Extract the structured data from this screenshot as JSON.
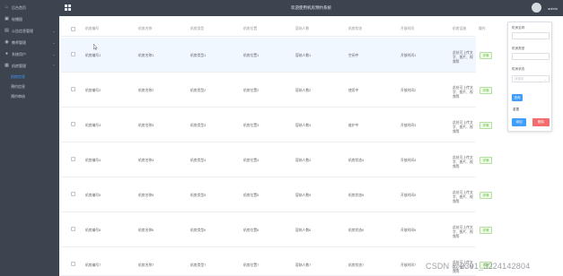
{
  "topbar": {
    "title": "欢迎使用机房预约系统",
    "admin": "admin"
  },
  "sidebar": {
    "items": [
      {
        "label": "后台首页",
        "icon": "home-icon"
      },
      {
        "label": "轮播图",
        "icon": "image-icon"
      },
      {
        "label": "公告信息管理",
        "icon": "notice-icon"
      },
      {
        "label": "教师管理",
        "icon": "teacher-icon"
      },
      {
        "label": "系统用户",
        "icon": "user-icon"
      },
      {
        "label": "机房管理",
        "icon": "computer-room-icon"
      }
    ],
    "sub_items": [
      {
        "label": "机房信息",
        "active": true
      },
      {
        "label": "预约信息",
        "active": false
      },
      {
        "label": "预约审核",
        "active": false
      }
    ]
  },
  "table": {
    "headers": [
      "机房编号",
      "机房名称",
      "机房类型",
      "机房位置",
      "容纳人数",
      "机房状态",
      "开放时间",
      "机房设施",
      "操作"
    ],
    "detail_label": "详情",
    "rows": [
      {
        "no": "机房编号1",
        "name": "机房名称1",
        "type": "机房类型1",
        "loc": "机房位置1",
        "cap": "容纳人数1",
        "status": "空闲中",
        "open": "开放时间1",
        "fac": "此处可上传文字、图片、视频等"
      },
      {
        "no": "机房编号2",
        "name": "机房名称2",
        "type": "机房类型2",
        "loc": "机房位置2",
        "cap": "容纳人数2",
        "status": "使用中",
        "open": "开放时间2",
        "fac": "此处可上传文字、图片、视频等"
      },
      {
        "no": "机房编号3",
        "name": "机房名称3",
        "type": "机房类型3",
        "loc": "机房位置3",
        "cap": "容纳人数3",
        "status": "维护中",
        "open": "开放时间3",
        "fac": "此处可上传文字、图片、视频等"
      },
      {
        "no": "机房编号4",
        "name": "机房名称4",
        "type": "机房类型4",
        "loc": "机房位置4",
        "cap": "容纳人数4",
        "status": "机房状态4",
        "open": "开放时间4",
        "fac": "此处可上传文字、图片、视频等"
      },
      {
        "no": "机房编号5",
        "name": "机房名称5",
        "type": "机房类型5",
        "loc": "机房位置5",
        "cap": "容纳人数5",
        "status": "机房状态5",
        "open": "开放时间5",
        "fac": "此处可上传文字、图片、视频等"
      },
      {
        "no": "机房编号6",
        "name": "机房名称6",
        "type": "机房类型6",
        "loc": "机房位置6",
        "cap": "容纳人数6",
        "status": "机房状态6",
        "open": "开放时间6",
        "fac": "此处可上传文字、图片、视频等"
      },
      {
        "no": "机房编号7",
        "name": "机房名称7",
        "type": "机房类型7",
        "loc": "机房位置7",
        "cap": "容纳人数7",
        "status": "机房状态7",
        "open": "开放时间7",
        "fac": "此处可上传文字、图片、视频等"
      }
    ]
  },
  "search_panel": {
    "name_label": "机房名称",
    "type_label": "机房类型",
    "status_label": "机房状态",
    "status_placeholder": "请选择",
    "search_button": "查询",
    "reset_button": "重置",
    "add_button": "添加",
    "delete_button": "删除"
  },
  "watermark": "CSDN @2301_3224142804",
  "colors": {
    "sidebar_bg": "#3c4450",
    "accent": "#409eff",
    "danger": "#f56c6c",
    "success": "#67c23a"
  }
}
